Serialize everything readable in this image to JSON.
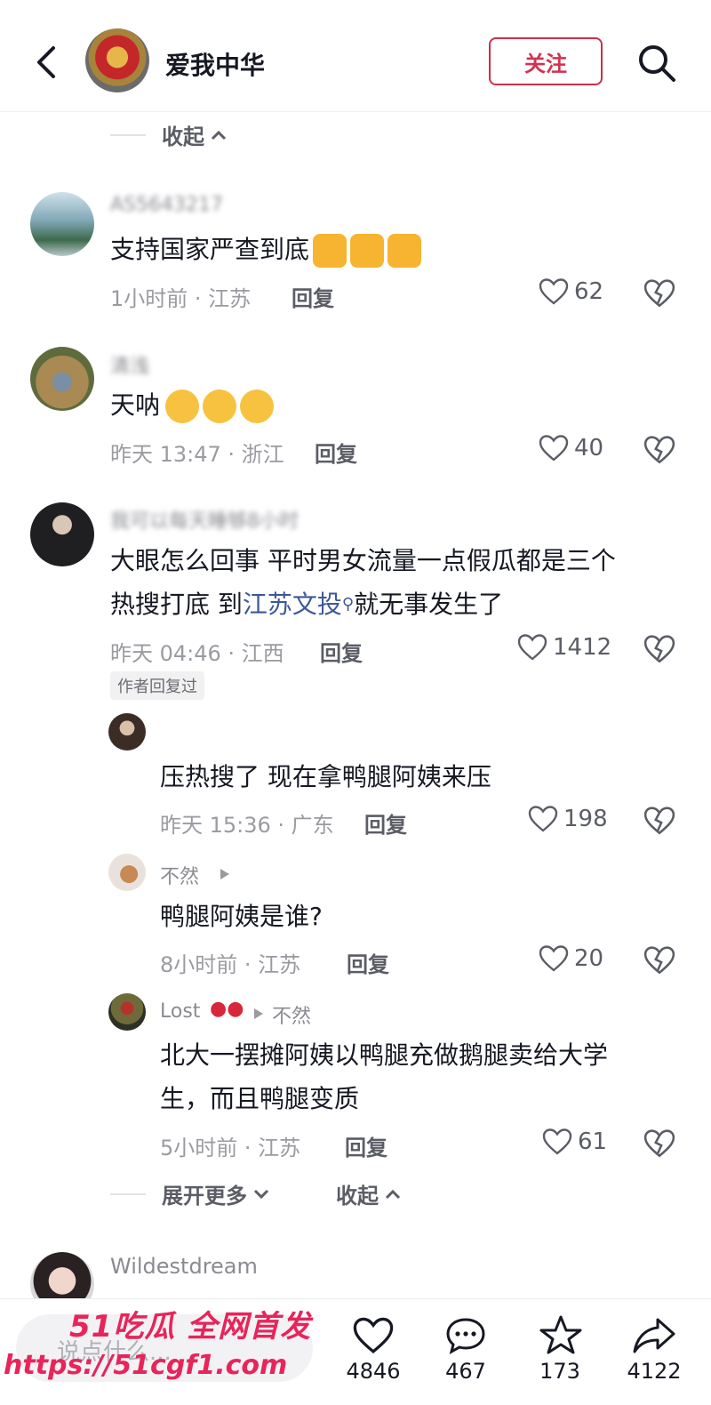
{
  "header": {
    "account_name": "爱我中华",
    "follow_label": "关注"
  },
  "collapse_top": "收起",
  "comments": [
    {
      "user": "AS5643217",
      "text": "支持国家严查到底",
      "time": "1小时前 · 江苏",
      "reply": "回复",
      "likes": "62"
    },
    {
      "user": "清浅",
      "text": "天呐",
      "time": "昨天 13:47 · 浙江",
      "reply": "回复",
      "likes": "40"
    },
    {
      "user": "我可以每天睡够8小时",
      "text_line1": "大眼怎么回事 平时男女流量一点假瓜都是三个",
      "text_line2_a": "热搜打底 到",
      "text_link": "江苏文投",
      "text_line2_b": "就无事发生了",
      "time": "昨天 04:46 · 江西",
      "reply": "回复",
      "likes": "1412",
      "author_tag": "作者回复过"
    }
  ],
  "replies": [
    {
      "user": "",
      "text": "压热搜了 现在拿鸭腿阿姨来压",
      "time": "昨天 15:36 · 广东",
      "reply": "回复",
      "likes": "198"
    },
    {
      "user": "不然",
      "text": "鸭腿阿姨是谁?",
      "time": "8小时前 · 江苏",
      "reply": "回复",
      "likes": "20"
    },
    {
      "user": "Lost",
      "reply_to": "不然",
      "text_line1": "北大一摆摊阿姨以鸭腿充做鹅腿卖给大学",
      "text_line2": "生，而且鸭腿变质",
      "time": "5小时前 · 江苏",
      "reply": "回复",
      "likes": "61"
    }
  ],
  "expand_more": "展开更多",
  "collapse_bottom": "收起",
  "next_comment": {
    "user": "Wildestdream"
  },
  "bottom_bar": {
    "input_placeholder": "说点什么...",
    "likes": "4846",
    "comments": "467",
    "favorites": "173",
    "shares": "4122"
  },
  "watermark": {
    "line1": "51吃瓜 全网首发",
    "line2": "https://51cgf1.com"
  },
  "colors": {
    "follow": "#d1324f",
    "link": "#3b5998",
    "watermark": "#e8245a"
  }
}
